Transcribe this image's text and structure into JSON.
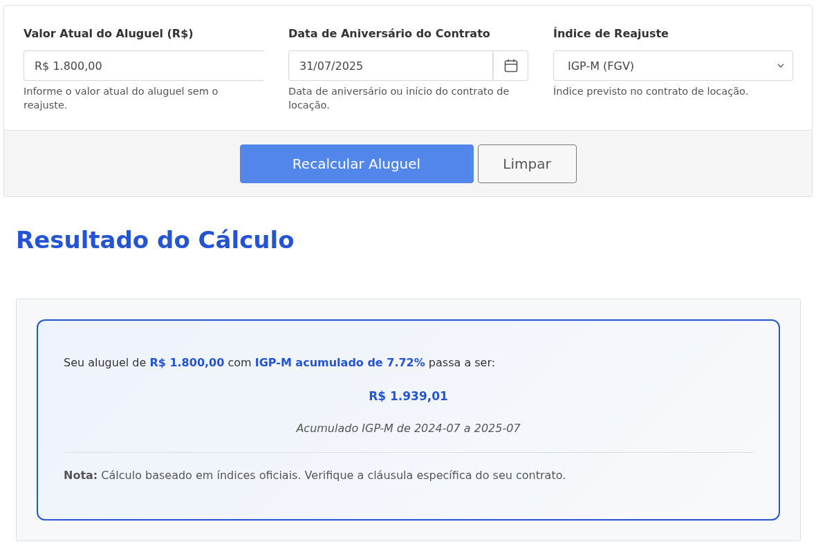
{
  "form": {
    "fields": [
      {
        "kind": "text",
        "label": "Valor Atual do Aluguel (R$)",
        "value": "R$ 1.800,00",
        "help": "Informe o valor atual do aluguel sem o reajuste."
      },
      {
        "kind": "date",
        "label": "Data de Aniversário do Contrato",
        "value": "31/07/2025",
        "help": "Data de aniversário ou início do contrato de locação."
      },
      {
        "kind": "select",
        "label": "Índice de Reajuste",
        "value": "IGP-M (FGV)",
        "help": "Índice previsto no contrato de locação."
      }
    ],
    "buttons": [
      {
        "kind": "primary",
        "label": "Recalcular Aluguel"
      },
      {
        "kind": "secondary",
        "label": "Limpar"
      }
    ]
  },
  "result": {
    "heading": "Resultado do Cálculo",
    "summary": "Seu aluguel de **R$ 1.800,00** com **IGP-M acumulado de 7.72%** passa a ser:",
    "new_value": "R$ 1.939,01",
    "period": "Acumulado IGP-M de 2024-07 a 2025-07",
    "note": "**Nota:** Cálculo baseado em índices oficiais. Verifique a cláusula específica do seu contrato."
  }
}
